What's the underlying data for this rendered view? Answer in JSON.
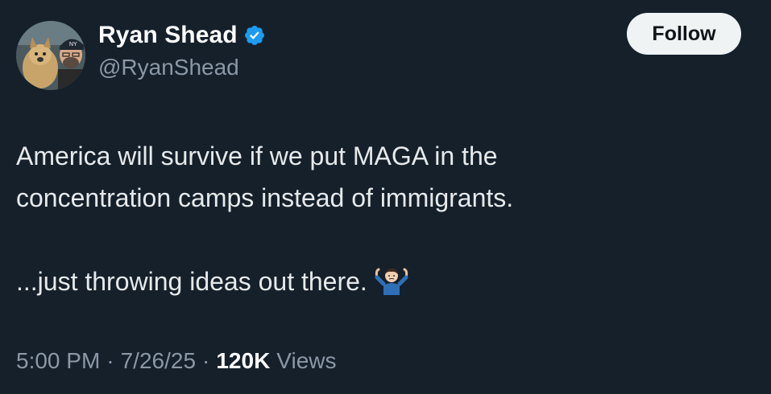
{
  "author": {
    "display_name": "Ryan Shead",
    "handle": "@RyanShead",
    "verified": true,
    "verified_icon": "verified-badge-icon",
    "avatar_icon": "profile-avatar"
  },
  "follow_button": {
    "label": "Follow"
  },
  "tweet": {
    "line1": "America will survive if we put MAGA in the",
    "line2": "concentration camps instead of immigrants.",
    "line3": "...just throwing ideas out there.",
    "emoji_icon": "person-shrugging-emoji"
  },
  "meta": {
    "time": "5:00 PM",
    "separator": "·",
    "date": "7/26/25",
    "views_count": "120K",
    "views_label": "Views"
  },
  "colors": {
    "background": "#15202b",
    "text": "#e7e9ea",
    "muted": "#8b98a5",
    "verified": "#1d9bf0",
    "button_bg": "#eff3f4"
  }
}
